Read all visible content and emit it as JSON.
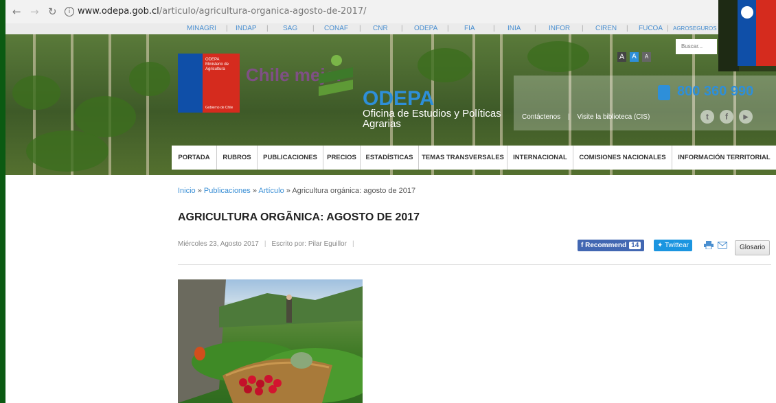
{
  "browser": {
    "url_host": "www.odepa.gob.cl",
    "url_path": "/articulo/agricultura-organica-agosto-de-2017/"
  },
  "toplinks": [
    "MINAGRI",
    "INDAP",
    "SAG",
    "CONAF",
    "CNR",
    "ODEPA",
    "FIA",
    "INIA",
    "INFOR",
    "CIREN",
    "FUCOA",
    "AGROSEGUROS"
  ],
  "header": {
    "logo_line1": "ODEPA",
    "logo_line2": "Ministerio de",
    "logo_line3": "Agricultura",
    "logo_footer": "Gobierno de Chile",
    "chile_mejor": "Chile mejor",
    "odepa": "ODEPA",
    "subtitle": "Oficina de Estudios y Políticas Agrarias",
    "phone": "800 360 990",
    "contact": "Contáctenos",
    "library": "Visite la biblioteca (CIS)",
    "search_placeholder": "Buscar...",
    "font_sizes": [
      "A",
      "A",
      "A"
    ]
  },
  "nav": [
    "PORTADA",
    "RUBROS",
    "PUBLICACIONES",
    "PRECIOS",
    "ESTADÍSTICAS",
    "TEMAS TRANSVERSALES",
    "INTERNACIONAL",
    "COMISIONES NACIONALES",
    "INFORMACIÓN TERRITORIAL"
  ],
  "breadcrumb": {
    "home": "Inicio",
    "publications": "Publicaciones",
    "article": "Artículo",
    "current": "Agricultura orgánica: agosto de 2017"
  },
  "article": {
    "title": "AGRICULTURA ORGÃNICA: AGOSTO DE 2017",
    "date": "Miércoles 23, Agosto 2017",
    "author": "Escrito por: Pilar Eguillor"
  },
  "share": {
    "fb_label": "Recommend",
    "fb_count": "14",
    "tw_label": "Twittear",
    "glosario": "Glosario"
  },
  "colors": {
    "accent_blue": "#2e8fd9",
    "chile_red": "#d52b1e",
    "chile_blue": "#0f4fa8",
    "facebook": "#4267b2",
    "twitter": "#1b95e0",
    "frame_green": "#0b5a12"
  }
}
